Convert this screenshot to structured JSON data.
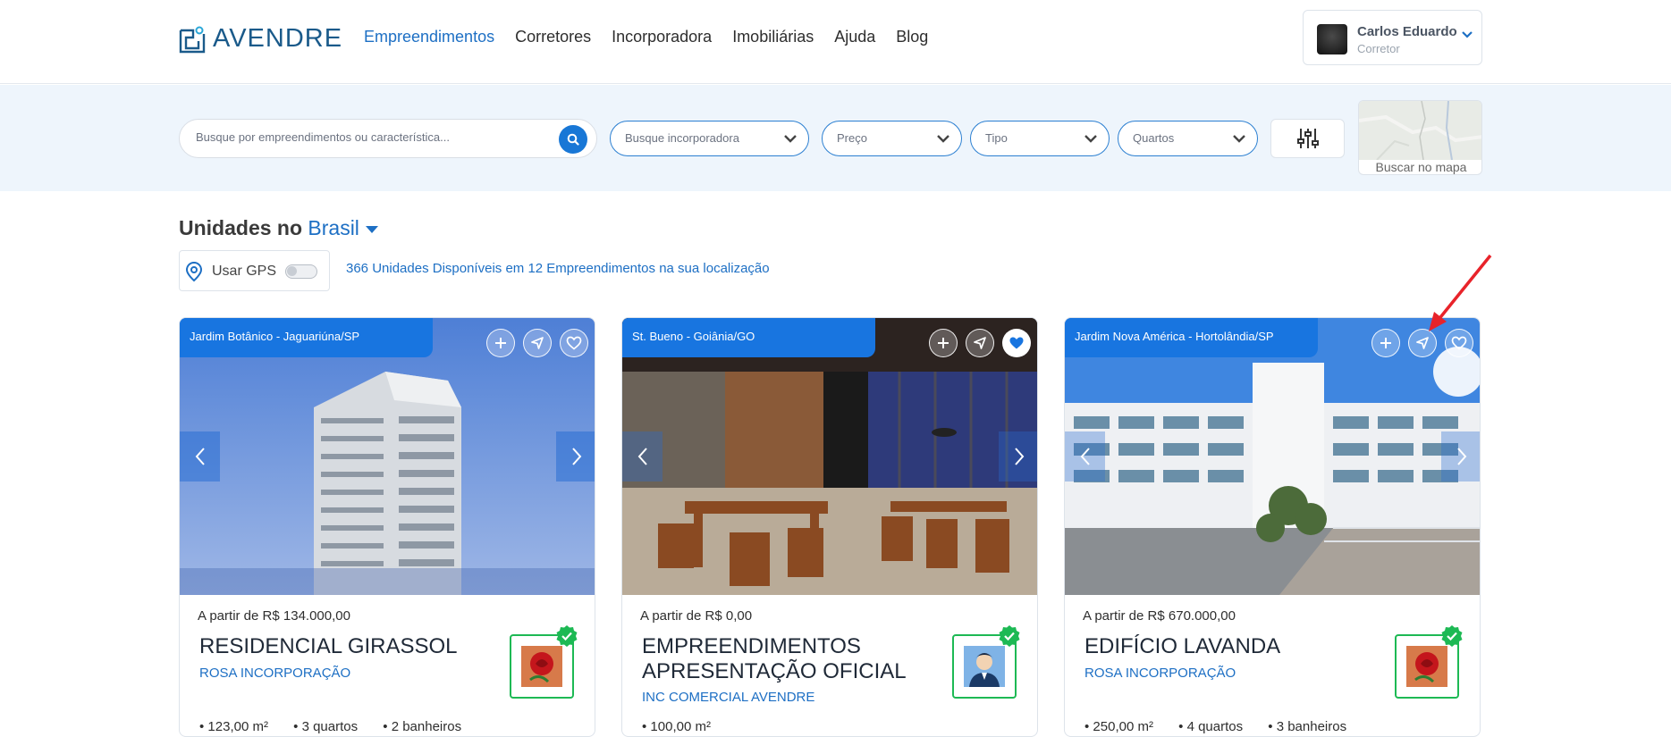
{
  "header": {
    "logo_text": "AVENDRE",
    "nav": [
      "Empreendimentos",
      "Corretores",
      "Incorporadora",
      "Imobiliárias",
      "Ajuda",
      "Blog"
    ],
    "active_nav": "Empreendimentos",
    "user": {
      "name": "Carlos Eduardo",
      "role": "Corretor"
    }
  },
  "filters": {
    "search_placeholder": "Busque por empreendimentos ou característica...",
    "incorporadora": "Busque incorporadora",
    "preco": "Preço",
    "tipo": "Tipo",
    "quartos": "Quartos",
    "map_label": "Buscar no mapa"
  },
  "section": {
    "title_prefix": "Unidades no",
    "location": "Brasil",
    "gps_label": "Usar GPS",
    "gps_enabled": false,
    "available_text": "366 Unidades Disponíveis em 12 Empreendimentos na sua localização"
  },
  "cards": [
    {
      "location": "Jardim Botânico - Jaguariúna/SP",
      "price": "A partir de R$ 134.000,00",
      "name": "RESIDENCIAL GIRASSOL",
      "incorporadora": "ROSA INCORPORAÇÃO",
      "favorited": false,
      "features": [
        "123,00 m²",
        "3 quartos",
        "2 banheiros"
      ]
    },
    {
      "location": "St. Bueno - Goiânia/GO",
      "price": "A partir de R$ 0,00",
      "name": "EMPREENDIMENTOS APRESENTAÇÃO OFICIAL",
      "incorporadora": "INC COMERCIAL AVENDRE",
      "favorited": true,
      "features": [
        "100,00 m²"
      ]
    },
    {
      "location": "Jardim Nova América - Hortolândia/SP",
      "price": "A partir de R$ 670.000,00",
      "name": "EDIFÍCIO LAVANDA",
      "incorporadora": "ROSA INCORPORAÇÃO",
      "favorited": false,
      "features": [
        "250,00 m²",
        "4 quartos",
        "3 banheiros"
      ]
    }
  ],
  "colors": {
    "accent": "#1d6fc4",
    "tag": "#1875e0",
    "verified": "#1db954",
    "annotation_arrow": "#e8232a"
  }
}
